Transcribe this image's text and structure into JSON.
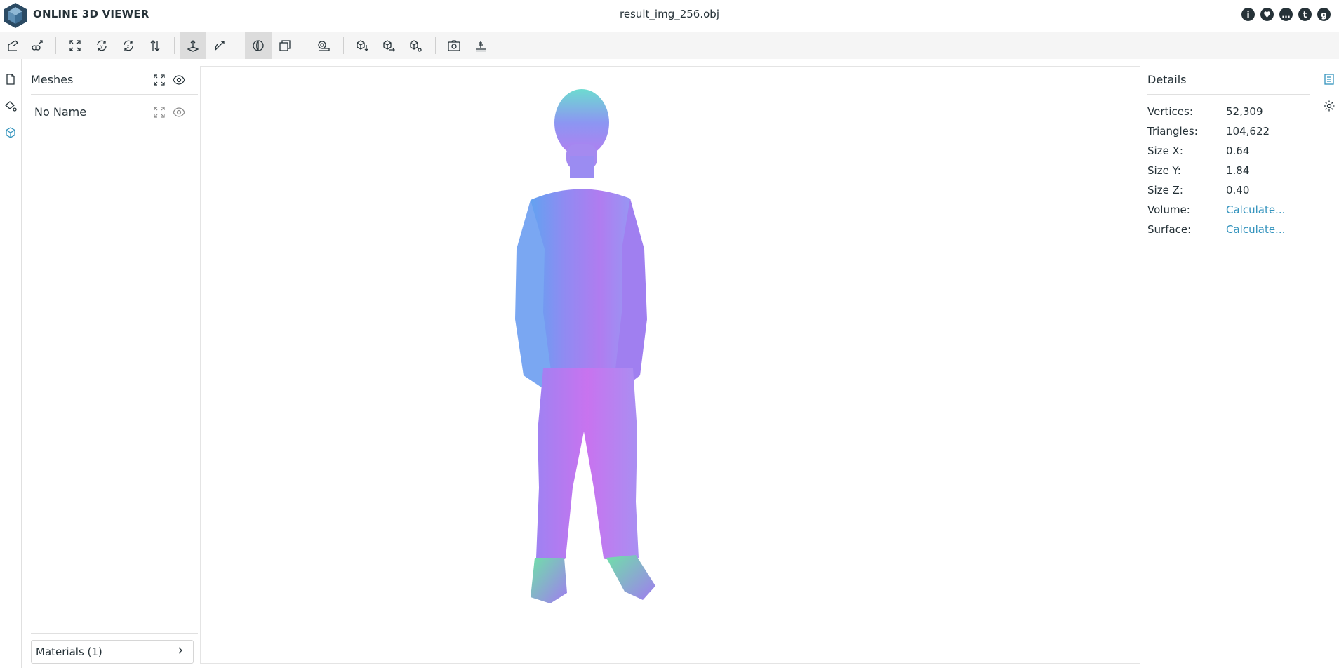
{
  "app": {
    "title": "ONLINE 3D VIEWER",
    "file_name": "result_img_256.obj"
  },
  "header_icons": [
    {
      "name": "info-icon",
      "glyph": "i"
    },
    {
      "name": "heart-icon",
      "glyph": "♥"
    },
    {
      "name": "feedback-icon",
      "glyph": "…"
    },
    {
      "name": "twitter-icon",
      "glyph": "t"
    },
    {
      "name": "github-icon",
      "glyph": "g"
    }
  ],
  "toolbar": {
    "buttons": [
      "open-file-icon",
      "open-url-icon",
      "fit-to-window-icon",
      "rotate-y-icon",
      "rotate-z-icon",
      "flip-axis-icon",
      "fixed-up-vector-icon",
      "free-orbit-icon",
      "perspective-camera-icon",
      "orthographic-camera-icon",
      "measure-icon",
      "download-icon",
      "export-icon",
      "share-icon",
      "snapshot-icon",
      "measure-ruler-icon"
    ],
    "selected": [
      "fixed-up-vector-icon",
      "perspective-camera-icon"
    ]
  },
  "left_nav": [
    "files-icon",
    "materials-icon",
    "meshes-icon"
  ],
  "meshes_panel": {
    "title": "Meshes",
    "items": [
      {
        "label": "No Name"
      }
    ],
    "materials_label": "Materials (1)"
  },
  "details": {
    "title": "Details",
    "rows": [
      {
        "key": "Vertices:",
        "value": "52,309",
        "link": false
      },
      {
        "key": "Triangles:",
        "value": "104,622",
        "link": false
      },
      {
        "key": "Size X:",
        "value": "0.64",
        "link": false
      },
      {
        "key": "Size Y:",
        "value": "1.84",
        "link": false
      },
      {
        "key": "Size Z:",
        "value": "0.40",
        "link": false
      },
      {
        "key": "Volume:",
        "value": "Calculate...",
        "link": true
      },
      {
        "key": "Surface:",
        "value": "Calculate...",
        "link": true
      }
    ]
  },
  "right_nav": [
    "details-icon",
    "settings-icon"
  ],
  "colors": {
    "accent": "#3393bd",
    "text": "#263238",
    "toolbar_bg": "#f5f5f5"
  }
}
